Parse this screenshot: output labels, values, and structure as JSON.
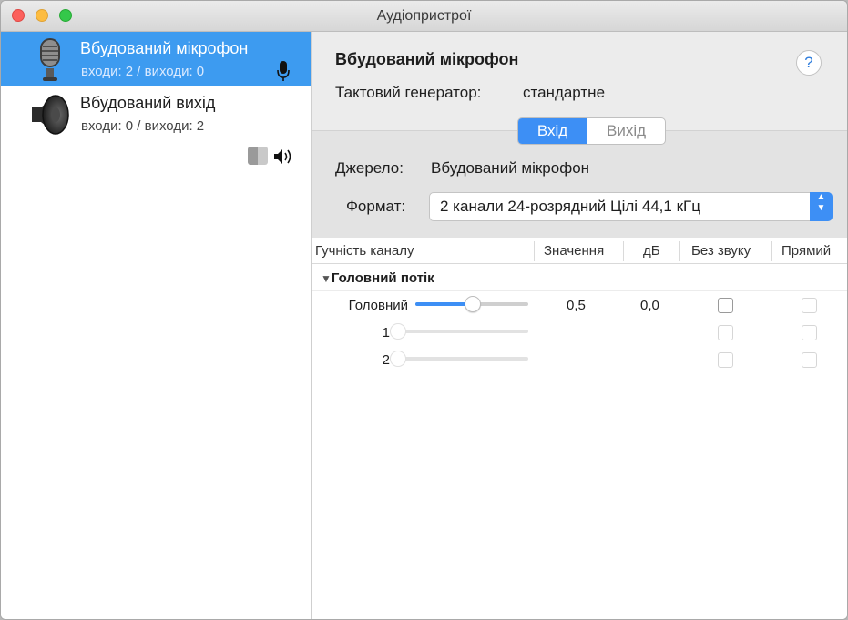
{
  "window": {
    "title": "Аудіопристрої"
  },
  "devices": [
    {
      "name": "Вбудований мікрофон",
      "io": "входи: 2 / виходи: 0",
      "icon": "microphone-icon"
    },
    {
      "name": "Вбудований вихід",
      "io": "входи: 0 / виходи: 2",
      "icon": "speaker-icon"
    }
  ],
  "toolbar": {
    "add": "+",
    "remove": "—",
    "gear": "⚙",
    "gear_caret": "⌄"
  },
  "detail": {
    "name": "Вбудований мікрофон",
    "help": "?",
    "clock_label": "Тактовий генератор:",
    "clock_value": "стандартне",
    "tabs": [
      {
        "label": "Вхід",
        "selected": true
      },
      {
        "label": "Вихід",
        "selected": false
      }
    ],
    "source_label": "Джерело:",
    "source_value": "Вбудований мікрофон",
    "format_label": "Формат:",
    "format_value": "2 канали 24-розрядний Цілі 44,1 кГц"
  },
  "table": {
    "headers": [
      "Гучність каналу",
      "Значення",
      "дБ",
      "Без звуку",
      "Прямий"
    ],
    "group": "Головний потік",
    "rows": [
      {
        "label": "Головний",
        "level": 0.5,
        "value": "0,5",
        "db": "0,0",
        "enabled": true
      },
      {
        "label": "1",
        "level": 0,
        "value": "",
        "db": "",
        "enabled": false
      },
      {
        "label": "2",
        "level": 0,
        "value": "",
        "db": "",
        "enabled": false
      }
    ]
  },
  "colors": {
    "accent": "#3d8ff5",
    "selection": "#3d9bf0"
  }
}
